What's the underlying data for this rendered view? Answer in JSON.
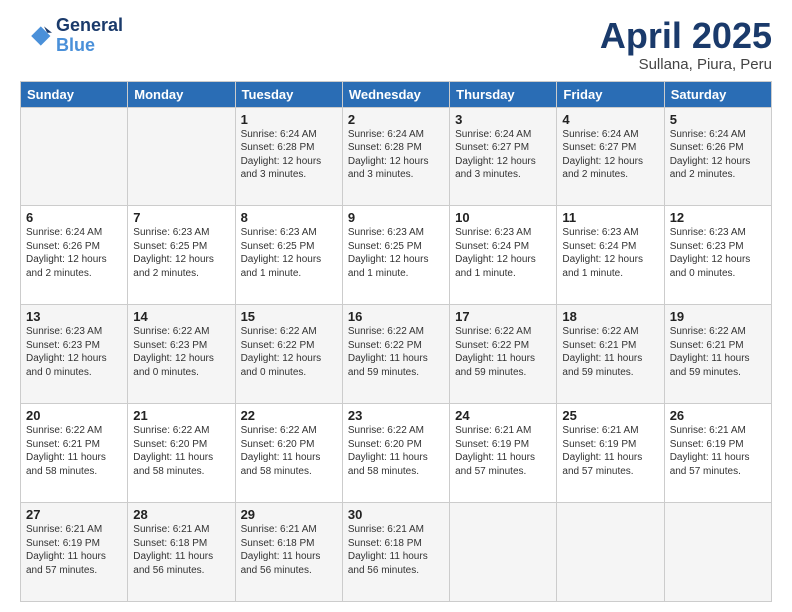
{
  "header": {
    "logo_line1": "General",
    "logo_line2": "Blue",
    "title": "April 2025",
    "subtitle": "Sullana, Piura, Peru"
  },
  "days_of_week": [
    "Sunday",
    "Monday",
    "Tuesday",
    "Wednesday",
    "Thursday",
    "Friday",
    "Saturday"
  ],
  "weeks": [
    [
      {
        "day": "",
        "sunrise": "",
        "sunset": "",
        "daylight": ""
      },
      {
        "day": "",
        "sunrise": "",
        "sunset": "",
        "daylight": ""
      },
      {
        "day": "1",
        "sunrise": "Sunrise: 6:24 AM",
        "sunset": "Sunset: 6:28 PM",
        "daylight": "Daylight: 12 hours and 3 minutes."
      },
      {
        "day": "2",
        "sunrise": "Sunrise: 6:24 AM",
        "sunset": "Sunset: 6:28 PM",
        "daylight": "Daylight: 12 hours and 3 minutes."
      },
      {
        "day": "3",
        "sunrise": "Sunrise: 6:24 AM",
        "sunset": "Sunset: 6:27 PM",
        "daylight": "Daylight: 12 hours and 3 minutes."
      },
      {
        "day": "4",
        "sunrise": "Sunrise: 6:24 AM",
        "sunset": "Sunset: 6:27 PM",
        "daylight": "Daylight: 12 hours and 2 minutes."
      },
      {
        "day": "5",
        "sunrise": "Sunrise: 6:24 AM",
        "sunset": "Sunset: 6:26 PM",
        "daylight": "Daylight: 12 hours and 2 minutes."
      }
    ],
    [
      {
        "day": "6",
        "sunrise": "Sunrise: 6:24 AM",
        "sunset": "Sunset: 6:26 PM",
        "daylight": "Daylight: 12 hours and 2 minutes."
      },
      {
        "day": "7",
        "sunrise": "Sunrise: 6:23 AM",
        "sunset": "Sunset: 6:25 PM",
        "daylight": "Daylight: 12 hours and 2 minutes."
      },
      {
        "day": "8",
        "sunrise": "Sunrise: 6:23 AM",
        "sunset": "Sunset: 6:25 PM",
        "daylight": "Daylight: 12 hours and 1 minute."
      },
      {
        "day": "9",
        "sunrise": "Sunrise: 6:23 AM",
        "sunset": "Sunset: 6:25 PM",
        "daylight": "Daylight: 12 hours and 1 minute."
      },
      {
        "day": "10",
        "sunrise": "Sunrise: 6:23 AM",
        "sunset": "Sunset: 6:24 PM",
        "daylight": "Daylight: 12 hours and 1 minute."
      },
      {
        "day": "11",
        "sunrise": "Sunrise: 6:23 AM",
        "sunset": "Sunset: 6:24 PM",
        "daylight": "Daylight: 12 hours and 1 minute."
      },
      {
        "day": "12",
        "sunrise": "Sunrise: 6:23 AM",
        "sunset": "Sunset: 6:23 PM",
        "daylight": "Daylight: 12 hours and 0 minutes."
      }
    ],
    [
      {
        "day": "13",
        "sunrise": "Sunrise: 6:23 AM",
        "sunset": "Sunset: 6:23 PM",
        "daylight": "Daylight: 12 hours and 0 minutes."
      },
      {
        "day": "14",
        "sunrise": "Sunrise: 6:22 AM",
        "sunset": "Sunset: 6:23 PM",
        "daylight": "Daylight: 12 hours and 0 minutes."
      },
      {
        "day": "15",
        "sunrise": "Sunrise: 6:22 AM",
        "sunset": "Sunset: 6:22 PM",
        "daylight": "Daylight: 12 hours and 0 minutes."
      },
      {
        "day": "16",
        "sunrise": "Sunrise: 6:22 AM",
        "sunset": "Sunset: 6:22 PM",
        "daylight": "Daylight: 11 hours and 59 minutes."
      },
      {
        "day": "17",
        "sunrise": "Sunrise: 6:22 AM",
        "sunset": "Sunset: 6:22 PM",
        "daylight": "Daylight: 11 hours and 59 minutes."
      },
      {
        "day": "18",
        "sunrise": "Sunrise: 6:22 AM",
        "sunset": "Sunset: 6:21 PM",
        "daylight": "Daylight: 11 hours and 59 minutes."
      },
      {
        "day": "19",
        "sunrise": "Sunrise: 6:22 AM",
        "sunset": "Sunset: 6:21 PM",
        "daylight": "Daylight: 11 hours and 59 minutes."
      }
    ],
    [
      {
        "day": "20",
        "sunrise": "Sunrise: 6:22 AM",
        "sunset": "Sunset: 6:21 PM",
        "daylight": "Daylight: 11 hours and 58 minutes."
      },
      {
        "day": "21",
        "sunrise": "Sunrise: 6:22 AM",
        "sunset": "Sunset: 6:20 PM",
        "daylight": "Daylight: 11 hours and 58 minutes."
      },
      {
        "day": "22",
        "sunrise": "Sunrise: 6:22 AM",
        "sunset": "Sunset: 6:20 PM",
        "daylight": "Daylight: 11 hours and 58 minutes."
      },
      {
        "day": "23",
        "sunrise": "Sunrise: 6:22 AM",
        "sunset": "Sunset: 6:20 PM",
        "daylight": "Daylight: 11 hours and 58 minutes."
      },
      {
        "day": "24",
        "sunrise": "Sunrise: 6:21 AM",
        "sunset": "Sunset: 6:19 PM",
        "daylight": "Daylight: 11 hours and 57 minutes."
      },
      {
        "day": "25",
        "sunrise": "Sunrise: 6:21 AM",
        "sunset": "Sunset: 6:19 PM",
        "daylight": "Daylight: 11 hours and 57 minutes."
      },
      {
        "day": "26",
        "sunrise": "Sunrise: 6:21 AM",
        "sunset": "Sunset: 6:19 PM",
        "daylight": "Daylight: 11 hours and 57 minutes."
      }
    ],
    [
      {
        "day": "27",
        "sunrise": "Sunrise: 6:21 AM",
        "sunset": "Sunset: 6:19 PM",
        "daylight": "Daylight: 11 hours and 57 minutes."
      },
      {
        "day": "28",
        "sunrise": "Sunrise: 6:21 AM",
        "sunset": "Sunset: 6:18 PM",
        "daylight": "Daylight: 11 hours and 56 minutes."
      },
      {
        "day": "29",
        "sunrise": "Sunrise: 6:21 AM",
        "sunset": "Sunset: 6:18 PM",
        "daylight": "Daylight: 11 hours and 56 minutes."
      },
      {
        "day": "30",
        "sunrise": "Sunrise: 6:21 AM",
        "sunset": "Sunset: 6:18 PM",
        "daylight": "Daylight: 11 hours and 56 minutes."
      },
      {
        "day": "",
        "sunrise": "",
        "sunset": "",
        "daylight": ""
      },
      {
        "day": "",
        "sunrise": "",
        "sunset": "",
        "daylight": ""
      },
      {
        "day": "",
        "sunrise": "",
        "sunset": "",
        "daylight": ""
      }
    ]
  ]
}
